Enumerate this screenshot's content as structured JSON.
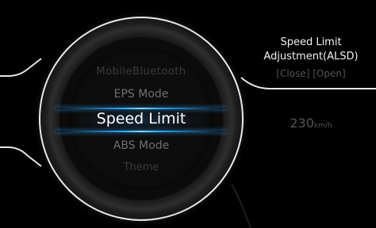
{
  "menu": {
    "items": [
      {
        "label": "MobileBluetooth",
        "state": "faded"
      },
      {
        "label": "EPS Mode",
        "state": "dim"
      },
      {
        "label": "Speed Limit",
        "state": "selected"
      },
      {
        "label": "ABS Mode",
        "state": "dim"
      },
      {
        "label": "Theme",
        "state": "faded"
      }
    ]
  },
  "panel": {
    "title_line1": "Speed Limit",
    "title_line2": "Adjustment(ALSD)",
    "option_close": "[Close]",
    "option_open": "[Open]",
    "speed_value": "230",
    "speed_unit": "km/h"
  },
  "colors": {
    "background": "#000000",
    "accent": "#2ea8ff",
    "text_selected": "#ffffff",
    "text_dim": "#6f6f6f",
    "text_faded": "#3b3b3b"
  }
}
